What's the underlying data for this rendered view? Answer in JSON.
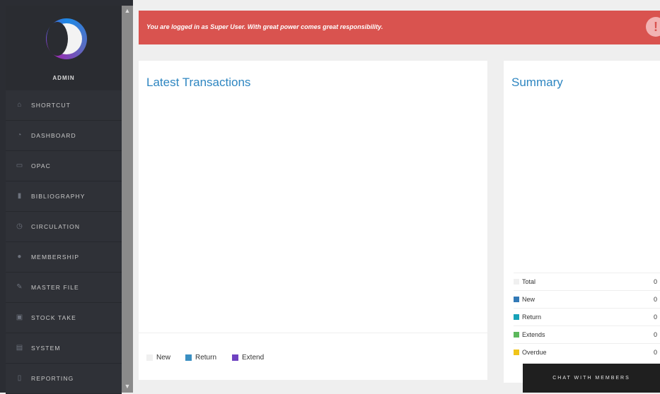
{
  "sidebar": {
    "user": "ADMIN",
    "items": [
      {
        "label": "SHORTCUT",
        "icon": "home-icon"
      },
      {
        "label": "DASHBOARD",
        "icon": "dashboard-icon"
      },
      {
        "label": "OPAC",
        "icon": "desktop-icon"
      },
      {
        "label": "BIBLIOGRAPHY",
        "icon": "bookmark-icon"
      },
      {
        "label": "CIRCULATION",
        "icon": "clock-icon"
      },
      {
        "label": "MEMBERSHIP",
        "icon": "user-icon"
      },
      {
        "label": "MASTER FILE",
        "icon": "pencil-icon"
      },
      {
        "label": "STOCK TAKE",
        "icon": "briefcase-icon"
      },
      {
        "label": "SYSTEM",
        "icon": "keyboard-icon"
      },
      {
        "label": "REPORTING",
        "icon": "file-icon"
      }
    ]
  },
  "alert": {
    "text": "You are logged in as Super User. With great power comes great responsibility."
  },
  "latest": {
    "title": "Latest Transactions",
    "legend": [
      {
        "label": "New",
        "color": "#f0f0f0"
      },
      {
        "label": "Return",
        "color": "#3a8fc2"
      },
      {
        "label": "Extend",
        "color": "#6f42c1"
      }
    ]
  },
  "summary": {
    "title": "Summary",
    "rows": [
      {
        "label": "Total",
        "value": "0",
        "color": "#f0f0f0"
      },
      {
        "label": "New",
        "value": "0",
        "color": "#337ab7"
      },
      {
        "label": "Return",
        "value": "0",
        "color": "#17a2b8"
      },
      {
        "label": "Extends",
        "value": "0",
        "color": "#5cb85c"
      },
      {
        "label": "Overdue",
        "value": "0",
        "color": "#f0c419"
      }
    ]
  },
  "chat": {
    "label": "CHAT WITH MEMBERS"
  }
}
